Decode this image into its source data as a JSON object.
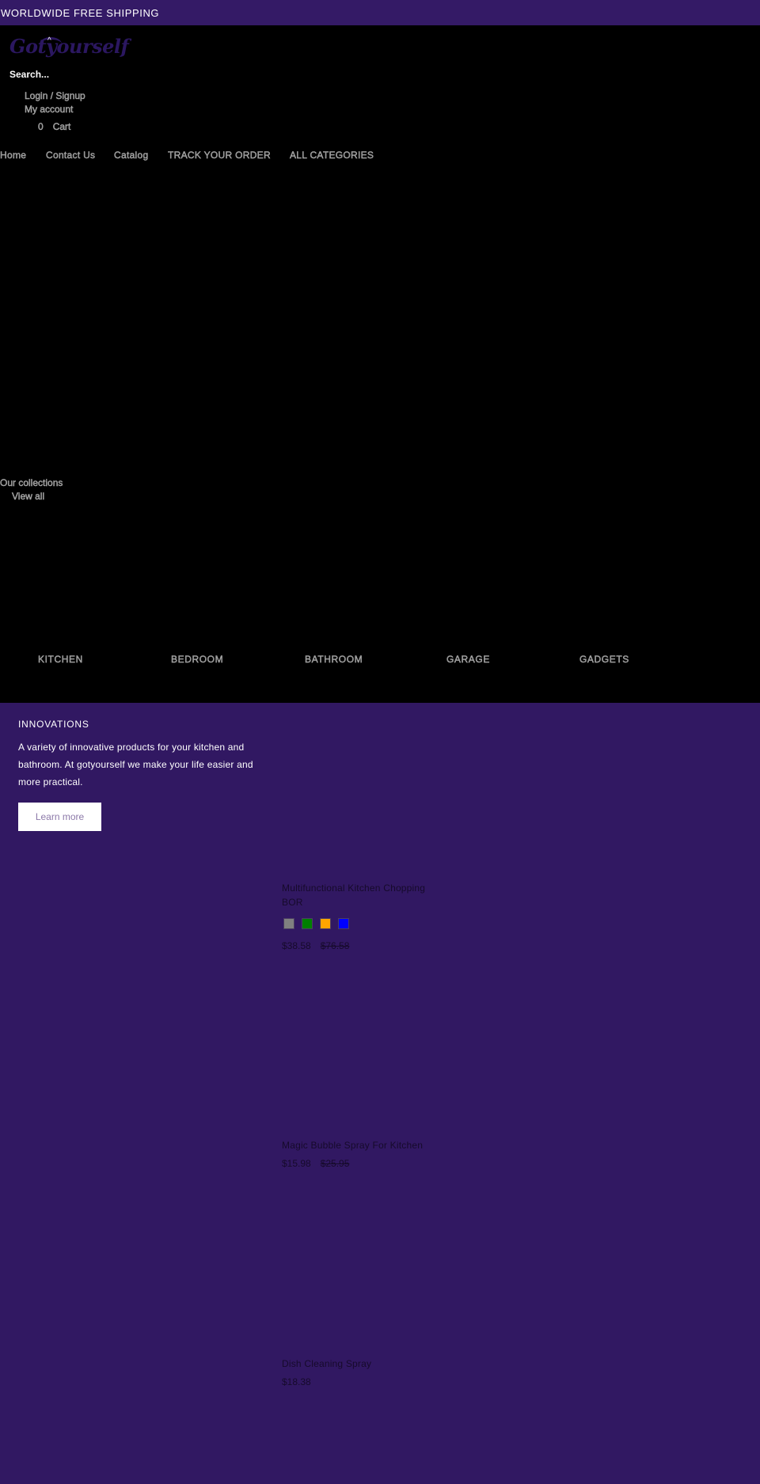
{
  "announcement": "WORLDWIDE FREE SHIPPING",
  "logo": {
    "text": "Gotyourself",
    "icon": "logo-icon"
  },
  "header": {
    "search_placeholder": "Search...",
    "login": "Login / Signup",
    "account": "My account",
    "cart_count": "0",
    "cart_label": "Cart"
  },
  "nav": [
    "Home",
    "Contact Us",
    "Catalog",
    "TRACK YOUR ORDER",
    "ALL CATEGORIES"
  ],
  "collections": {
    "title": "Our collections",
    "view_all": "View all"
  },
  "categories": [
    "KITCHEN",
    "BEDROOM",
    "BATHROOM",
    "GARAGE",
    "GADGETS"
  ],
  "innovations": {
    "title": "INNOVATIONS",
    "text": "A variety of innovative products for your kitchen and bathroom. At gotyourself we make your life easier and more practical.",
    "button": "Learn more"
  },
  "products": [
    {
      "title": "Multifunctional Kitchen Chopping BOR",
      "price": "$38.58",
      "compare_price": "$76.58",
      "swatches": [
        "#808080",
        "#008000",
        "#ffa500",
        "#0000ff"
      ]
    },
    {
      "title": "Magic Bubble Spray For Kitchen",
      "price": "$15.98",
      "compare_price": "$25.95"
    },
    {
      "title": "Dish Cleaning Spray",
      "price": "$18.38"
    }
  ],
  "colors": {
    "accent": "#311862",
    "header_bg": "#000000"
  }
}
